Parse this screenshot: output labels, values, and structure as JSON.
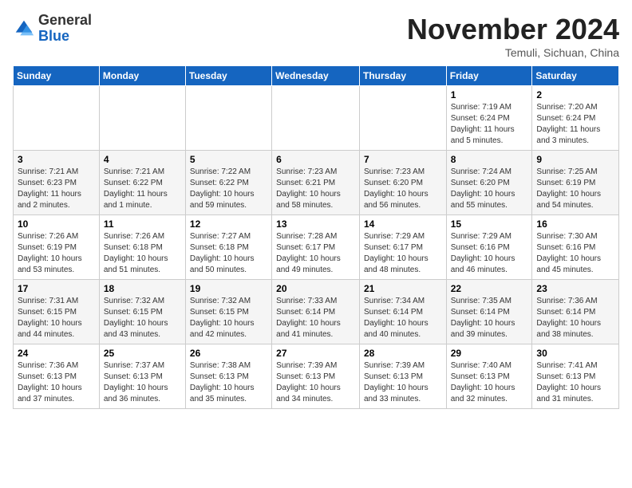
{
  "header": {
    "logo_general": "General",
    "logo_blue": "Blue",
    "month_title": "November 2024",
    "location": "Temuli, Sichuan, China"
  },
  "days_of_week": [
    "Sunday",
    "Monday",
    "Tuesday",
    "Wednesday",
    "Thursday",
    "Friday",
    "Saturday"
  ],
  "weeks": [
    [
      {
        "day": "",
        "info": ""
      },
      {
        "day": "",
        "info": ""
      },
      {
        "day": "",
        "info": ""
      },
      {
        "day": "",
        "info": ""
      },
      {
        "day": "",
        "info": ""
      },
      {
        "day": "1",
        "info": "Sunrise: 7:19 AM\nSunset: 6:24 PM\nDaylight: 11 hours and 5 minutes."
      },
      {
        "day": "2",
        "info": "Sunrise: 7:20 AM\nSunset: 6:24 PM\nDaylight: 11 hours and 3 minutes."
      }
    ],
    [
      {
        "day": "3",
        "info": "Sunrise: 7:21 AM\nSunset: 6:23 PM\nDaylight: 11 hours and 2 minutes."
      },
      {
        "day": "4",
        "info": "Sunrise: 7:21 AM\nSunset: 6:22 PM\nDaylight: 11 hours and 1 minute."
      },
      {
        "day": "5",
        "info": "Sunrise: 7:22 AM\nSunset: 6:22 PM\nDaylight: 10 hours and 59 minutes."
      },
      {
        "day": "6",
        "info": "Sunrise: 7:23 AM\nSunset: 6:21 PM\nDaylight: 10 hours and 58 minutes."
      },
      {
        "day": "7",
        "info": "Sunrise: 7:23 AM\nSunset: 6:20 PM\nDaylight: 10 hours and 56 minutes."
      },
      {
        "day": "8",
        "info": "Sunrise: 7:24 AM\nSunset: 6:20 PM\nDaylight: 10 hours and 55 minutes."
      },
      {
        "day": "9",
        "info": "Sunrise: 7:25 AM\nSunset: 6:19 PM\nDaylight: 10 hours and 54 minutes."
      }
    ],
    [
      {
        "day": "10",
        "info": "Sunrise: 7:26 AM\nSunset: 6:19 PM\nDaylight: 10 hours and 53 minutes."
      },
      {
        "day": "11",
        "info": "Sunrise: 7:26 AM\nSunset: 6:18 PM\nDaylight: 10 hours and 51 minutes."
      },
      {
        "day": "12",
        "info": "Sunrise: 7:27 AM\nSunset: 6:18 PM\nDaylight: 10 hours and 50 minutes."
      },
      {
        "day": "13",
        "info": "Sunrise: 7:28 AM\nSunset: 6:17 PM\nDaylight: 10 hours and 49 minutes."
      },
      {
        "day": "14",
        "info": "Sunrise: 7:29 AM\nSunset: 6:17 PM\nDaylight: 10 hours and 48 minutes."
      },
      {
        "day": "15",
        "info": "Sunrise: 7:29 AM\nSunset: 6:16 PM\nDaylight: 10 hours and 46 minutes."
      },
      {
        "day": "16",
        "info": "Sunrise: 7:30 AM\nSunset: 6:16 PM\nDaylight: 10 hours and 45 minutes."
      }
    ],
    [
      {
        "day": "17",
        "info": "Sunrise: 7:31 AM\nSunset: 6:15 PM\nDaylight: 10 hours and 44 minutes."
      },
      {
        "day": "18",
        "info": "Sunrise: 7:32 AM\nSunset: 6:15 PM\nDaylight: 10 hours and 43 minutes."
      },
      {
        "day": "19",
        "info": "Sunrise: 7:32 AM\nSunset: 6:15 PM\nDaylight: 10 hours and 42 minutes."
      },
      {
        "day": "20",
        "info": "Sunrise: 7:33 AM\nSunset: 6:14 PM\nDaylight: 10 hours and 41 minutes."
      },
      {
        "day": "21",
        "info": "Sunrise: 7:34 AM\nSunset: 6:14 PM\nDaylight: 10 hours and 40 minutes."
      },
      {
        "day": "22",
        "info": "Sunrise: 7:35 AM\nSunset: 6:14 PM\nDaylight: 10 hours and 39 minutes."
      },
      {
        "day": "23",
        "info": "Sunrise: 7:36 AM\nSunset: 6:14 PM\nDaylight: 10 hours and 38 minutes."
      }
    ],
    [
      {
        "day": "24",
        "info": "Sunrise: 7:36 AM\nSunset: 6:13 PM\nDaylight: 10 hours and 37 minutes."
      },
      {
        "day": "25",
        "info": "Sunrise: 7:37 AM\nSunset: 6:13 PM\nDaylight: 10 hours and 36 minutes."
      },
      {
        "day": "26",
        "info": "Sunrise: 7:38 AM\nSunset: 6:13 PM\nDaylight: 10 hours and 35 minutes."
      },
      {
        "day": "27",
        "info": "Sunrise: 7:39 AM\nSunset: 6:13 PM\nDaylight: 10 hours and 34 minutes."
      },
      {
        "day": "28",
        "info": "Sunrise: 7:39 AM\nSunset: 6:13 PM\nDaylight: 10 hours and 33 minutes."
      },
      {
        "day": "29",
        "info": "Sunrise: 7:40 AM\nSunset: 6:13 PM\nDaylight: 10 hours and 32 minutes."
      },
      {
        "day": "30",
        "info": "Sunrise: 7:41 AM\nSunset: 6:13 PM\nDaylight: 10 hours and 31 minutes."
      }
    ]
  ]
}
